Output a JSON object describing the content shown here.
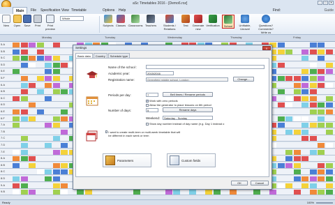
{
  "window": {
    "title": "aSc Timetables 2016 - [Demo6.roz]",
    "ctrls": [
      "–",
      "□",
      "✕"
    ]
  },
  "menu": {
    "items": [
      "Main",
      "File",
      "Specification",
      "View",
      "Timetable",
      "Options",
      "Help"
    ],
    "find": "Find:",
    "guide": "Guide"
  },
  "ribbon": {
    "new": "New",
    "open": "Open",
    "save": "Save",
    "print": "Print",
    "print_preview": "Print preview",
    "whole": "Whole",
    "subjects": "Subjects",
    "classes": "Classes",
    "classrooms": "Classrooms",
    "teachers": "Teachers",
    "students": "Students / Relations",
    "test": "Test",
    "generate": "Generate new",
    "verification": "Verification",
    "school": "School",
    "unfitable": "Unfitable, Unravel",
    "questions": "Questions? Comments? Write us"
  },
  "grid": {
    "day_headers": [
      "Monday",
      "Tuesday",
      "Wednesday",
      "Thursday",
      "Friday"
    ],
    "row_labels": [
      "5.A",
      "5.B",
      "5.C",
      "5.D",
      "5.E",
      "5.F",
      "6.A",
      "6.B",
      "6.C",
      "6.D",
      "6.E",
      "6.F",
      "7.A",
      "7.B",
      "7.C",
      "7.D",
      "7.E",
      "8.A",
      "8.B",
      "8.C",
      "8.D",
      "9.A",
      "9.B"
    ]
  },
  "dialog": {
    "title": "Settings",
    "close": "X",
    "tabs": [
      "Basic data",
      "Country",
      "Schedule type"
    ],
    "school_name_label": "Name of the school :",
    "school_name_value": "",
    "academic_year_label": "Academic year:",
    "academic_year_value": "2015/2016",
    "registration_label": "Registration name:",
    "registration_value": "Greenfield middle school, London",
    "change_button": "Change...",
    "periods_label": "Periods per day:",
    "periods_value": "7",
    "bell_button": "Bell times / Rename periods",
    "work_zero": "Work with zero periods",
    "allow_6th": "Allow the generator to place lessons on 6th period",
    "days_label": "Number of days:",
    "days_value": "5",
    "rename_days_button": "Rename days",
    "weekend_label": "Weekend:",
    "weekend_value": "Saturday - Sunday",
    "show_day_number": "Show day number instead of day name (e.g. Day 1 instead o",
    "multiweek_text": "I want to create multi-term or multi-week timetable that will be different in each week or term",
    "parameters_button": "Parameters",
    "custom_fields_button": "Custom fields",
    "ok_button": "OK",
    "cancel_button": "Cancel"
  },
  "status": {
    "text": "Ready",
    "zoom": "100%"
  }
}
